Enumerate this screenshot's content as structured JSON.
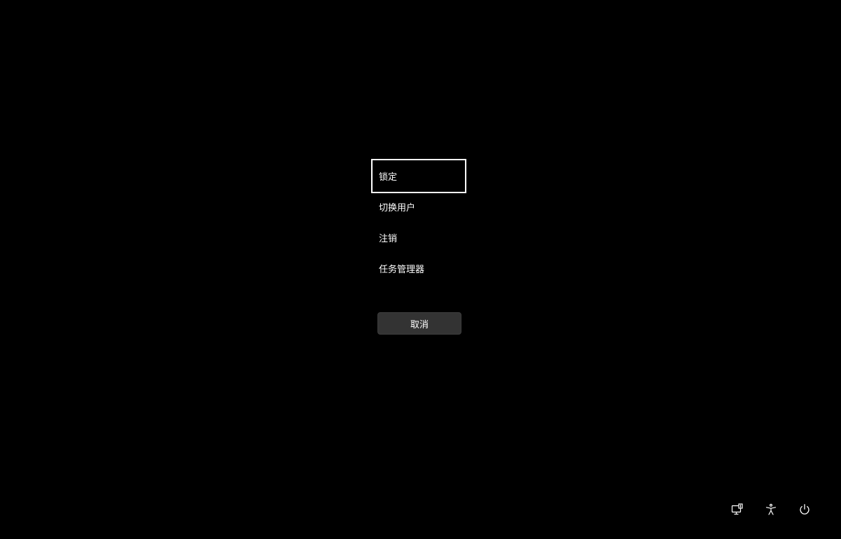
{
  "menu": {
    "items": [
      {
        "label": "锁定",
        "focused": true
      },
      {
        "label": "切换用户"
      },
      {
        "label": "注销"
      },
      {
        "label": "任务管理器"
      }
    ]
  },
  "cancel": {
    "label": "取消"
  },
  "tray": {
    "icons": [
      "network-icon",
      "accessibility-icon",
      "power-icon"
    ]
  },
  "colors": {
    "background": "#000000",
    "text": "#ffffff",
    "button": "#333333"
  }
}
